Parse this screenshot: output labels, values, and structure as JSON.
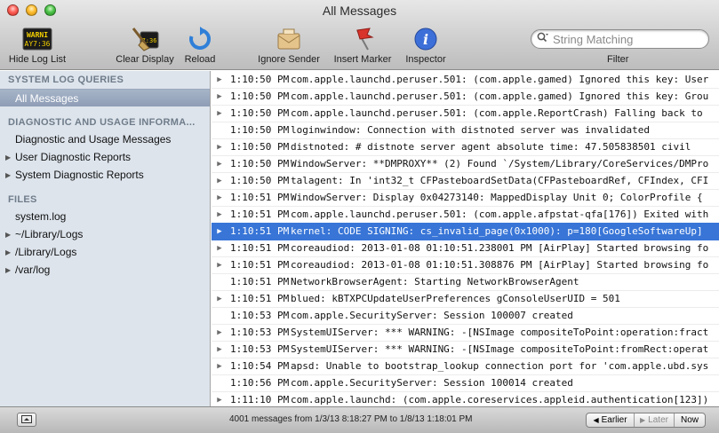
{
  "window": {
    "title": "All Messages"
  },
  "toolbar": {
    "hide_log_list": "Hide Log List",
    "clear_display": "Clear Display",
    "reload": "Reload",
    "ignore_sender": "Ignore Sender",
    "insert_marker": "Insert Marker",
    "inspector": "Inspector",
    "filter_label": "Filter",
    "search_placeholder": "String Matching",
    "log_icon_text": "WARNI",
    "log_icon_time": "AY7:36"
  },
  "sidebar": {
    "sections": [
      {
        "title": "SYSTEM LOG QUERIES"
      },
      {
        "title": "DIAGNOSTIC AND USAGE INFORMA..."
      },
      {
        "title": "FILES"
      }
    ],
    "items": [
      {
        "label": "All Messages",
        "selected": true
      },
      {
        "label": "Diagnostic and Usage Messages"
      },
      {
        "label": "User Diagnostic Reports",
        "disclosure": true
      },
      {
        "label": "System Diagnostic Reports",
        "disclosure": true
      },
      {
        "label": "system.log"
      },
      {
        "label": "~/Library/Logs",
        "disclosure": true
      },
      {
        "label": "/Library/Logs",
        "disclosure": true
      },
      {
        "label": "/var/log",
        "disclosure": true
      }
    ]
  },
  "log": {
    "rows": [
      {
        "time": "1:10:50 PM",
        "msg": "com.apple.launchd.peruser.501: (com.apple.gamed) Ignored this key: User",
        "disclosure": true
      },
      {
        "time": "1:10:50 PM",
        "msg": "com.apple.launchd.peruser.501: (com.apple.gamed) Ignored this key: Grou",
        "disclosure": true
      },
      {
        "time": "1:10:50 PM",
        "msg": "com.apple.launchd.peruser.501: (com.apple.ReportCrash) Falling back to",
        "disclosure": true
      },
      {
        "time": "1:10:50 PM",
        "msg": "loginwindow: Connection with distnoted server was invalidated",
        "disclosure": false
      },
      {
        "time": "1:10:50 PM",
        "msg": "distnoted: # distnote server agent  absolute time: 47.505838501   civil",
        "disclosure": true
      },
      {
        "time": "1:10:50 PM",
        "msg": "WindowServer: **DMPROXY** (2) Found `/System/Library/CoreServices/DMPro",
        "disclosure": true
      },
      {
        "time": "1:10:50 PM",
        "msg": "talagent: In 'int32_t CFPasteboardSetData(CFPasteboardRef, CFIndex, CFI",
        "disclosure": true
      },
      {
        "time": "1:10:51 PM",
        "msg": "WindowServer: Display 0x04273140: MappedDisplay Unit 0; ColorProfile {",
        "disclosure": true
      },
      {
        "time": "1:10:51 PM",
        "msg": "com.apple.launchd.peruser.501: (com.apple.afpstat-qfa[176]) Exited with",
        "disclosure": true
      },
      {
        "time": "1:10:51 PM",
        "msg": "kernel: CODE SIGNING: cs_invalid_page(0x1000): p=180[GoogleSoftwareUp]",
        "disclosure": true,
        "selected": true
      },
      {
        "time": "1:10:51 PM",
        "msg": "coreaudiod: 2013-01-08 01:10:51.238001 PM [AirPlay] Started browsing fo",
        "disclosure": true
      },
      {
        "time": "1:10:51 PM",
        "msg": "coreaudiod: 2013-01-08 01:10:51.308876 PM [AirPlay] Started browsing fo",
        "disclosure": true
      },
      {
        "time": "1:10:51 PM",
        "msg": "NetworkBrowserAgent: Starting NetworkBrowserAgent",
        "disclosure": false
      },
      {
        "time": "1:10:51 PM",
        "msg": "blued: kBTXPCUpdateUserPreferences gConsoleUserUID = 501",
        "disclosure": true
      },
      {
        "time": "1:10:53 PM",
        "msg": "com.apple.SecurityServer: Session 100007 created",
        "disclosure": false
      },
      {
        "time": "1:10:53 PM",
        "msg": "SystemUIServer: *** WARNING: -[NSImage compositeToPoint:operation:fract",
        "disclosure": true
      },
      {
        "time": "1:10:53 PM",
        "msg": "SystemUIServer: *** WARNING: -[NSImage compositeToPoint:fromRect:operat",
        "disclosure": true
      },
      {
        "time": "1:10:54 PM",
        "msg": "apsd: Unable to bootstrap_lookup connection port for 'com.apple.ubd.sys",
        "disclosure": true
      },
      {
        "time": "1:10:56 PM",
        "msg": "com.apple.SecurityServer: Session 100014 created",
        "disclosure": false
      },
      {
        "time": "1:11:10 PM",
        "msg": "com.apple.launchd: (com.apple.coreservices.appleid.authentication[123])",
        "disclosure": true
      }
    ]
  },
  "status": {
    "text": "4001 messages from 1/3/13 8:18:27 PM to 1/8/13 1:18:01 PM",
    "earlier": "Earlier",
    "later": "Later",
    "now": "Now"
  },
  "colors": {
    "selection": "#3875d7",
    "sidebar_bg": "#dde4ec",
    "sidebar_header": "#6f7c8a"
  }
}
